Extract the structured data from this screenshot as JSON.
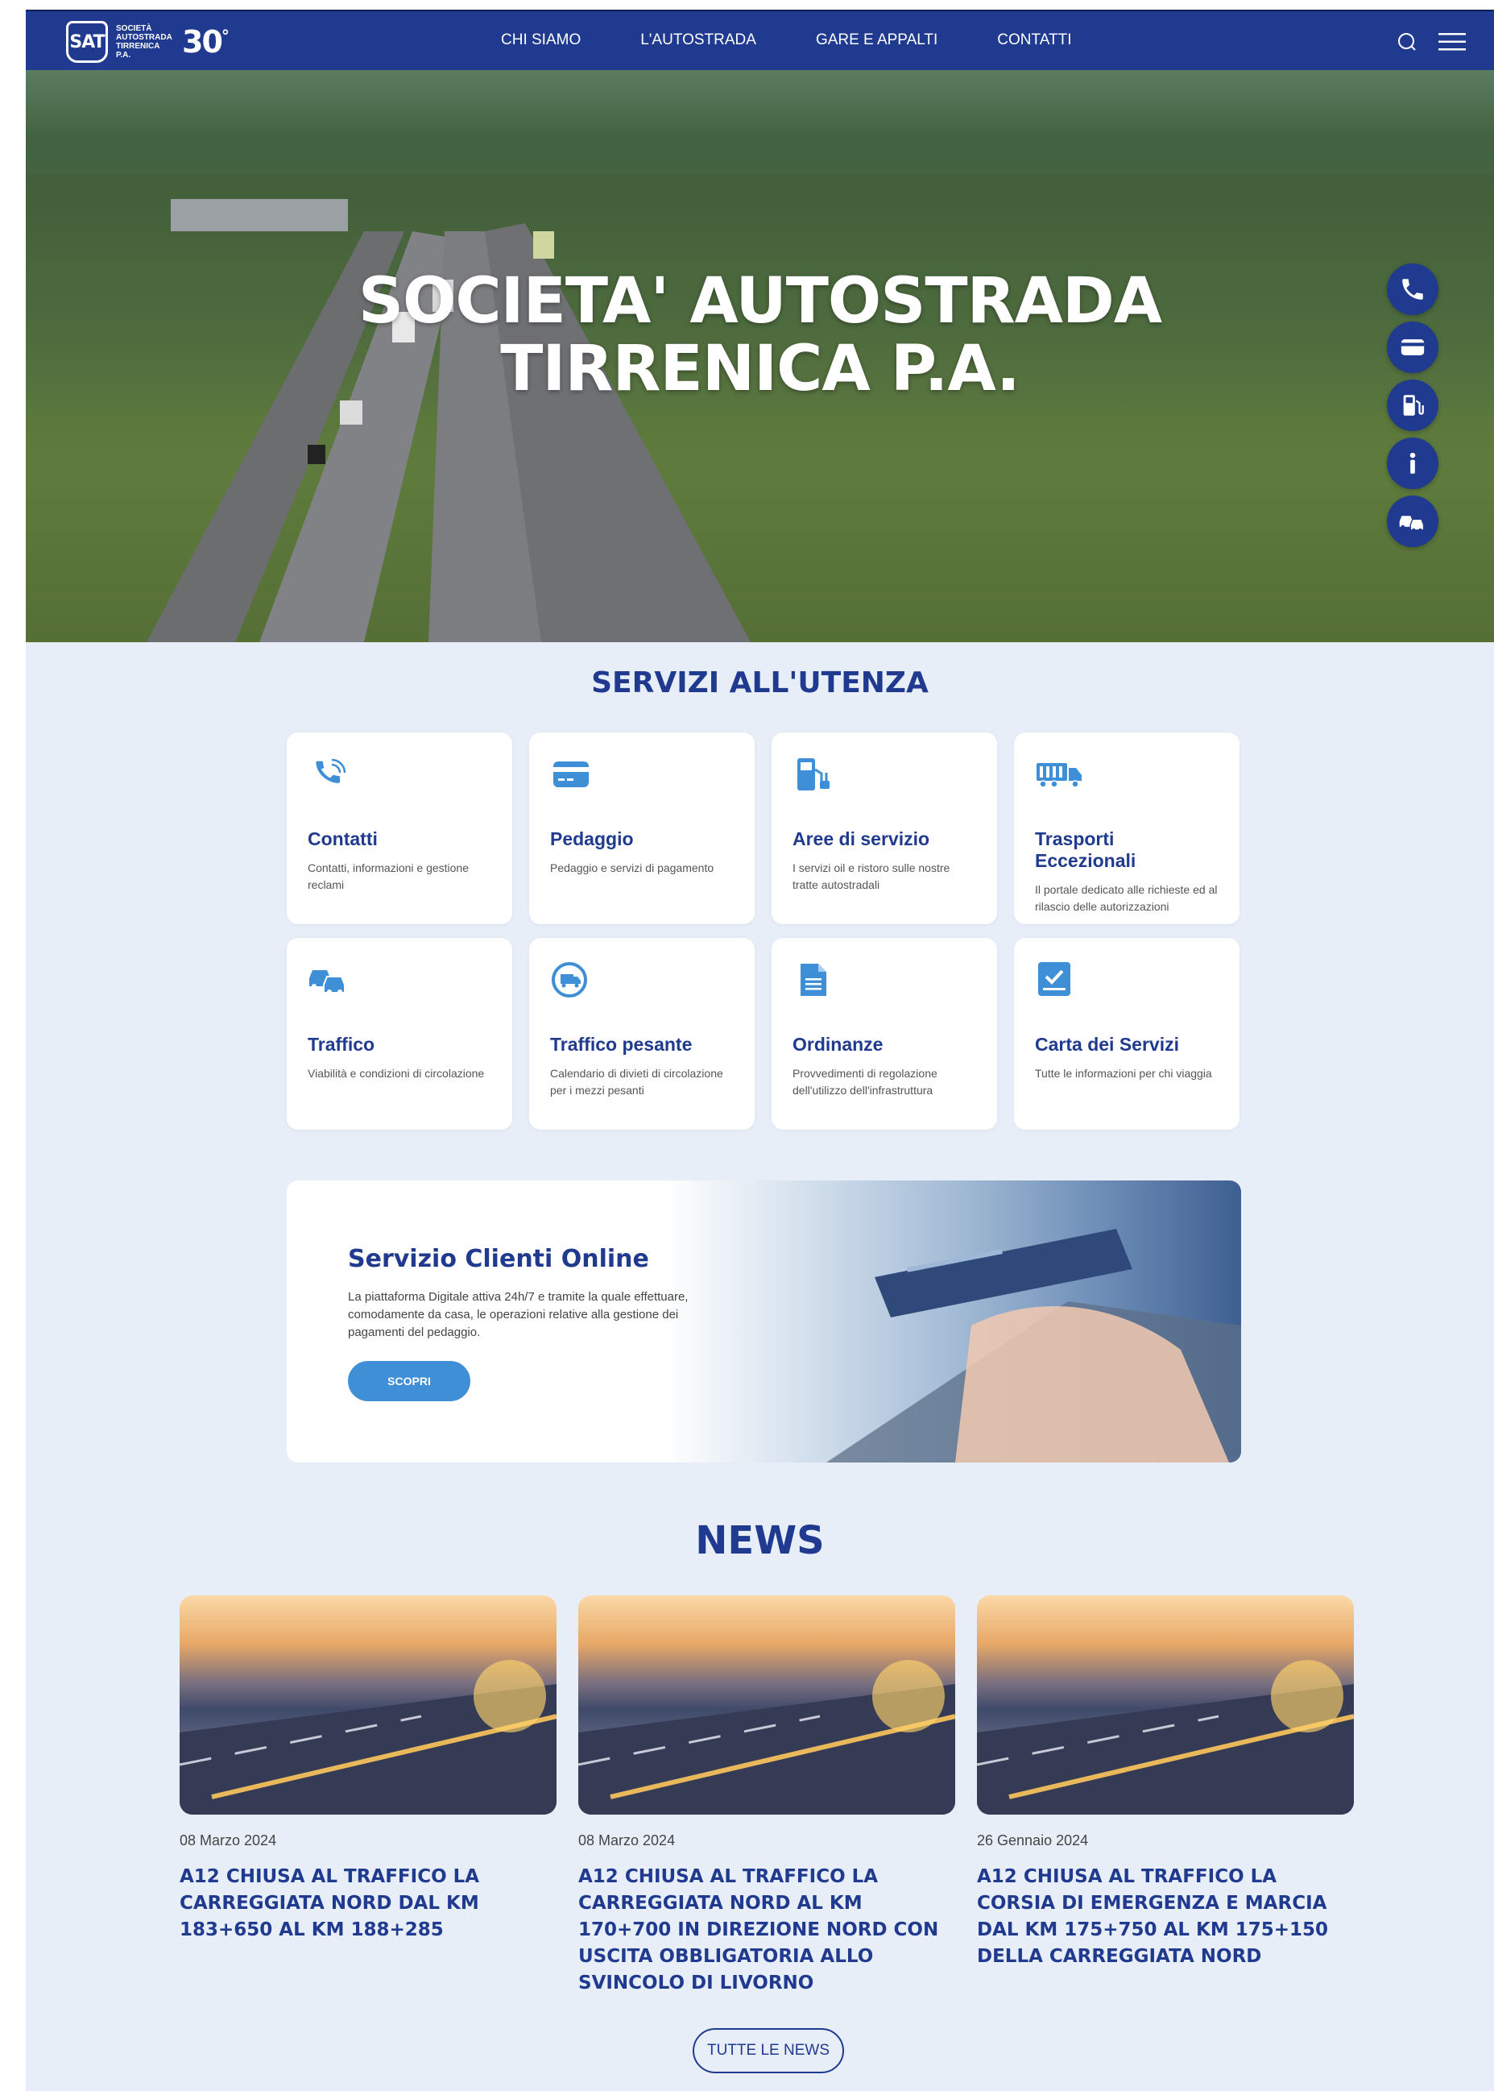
{
  "header": {
    "logo_text": "SAT",
    "logo_subtitle": "SOCIETÀ AUTOSTRADA TIRRENICA P.A.",
    "anniversary": "30",
    "anniversary_mark": "°",
    "menu": [
      {
        "label": "CHI SIAMO"
      },
      {
        "label": "L'AUTOSTRADA"
      },
      {
        "label": "GARE E APPALTI"
      },
      {
        "label": "CONTATTI"
      }
    ],
    "icons": [
      "search-icon",
      "hamburger-menu-icon"
    ]
  },
  "hero": {
    "title_line1": "SOCIETA' AUTOSTRADA",
    "title_line2": "TIRRENICA P.A.",
    "quick_icons": [
      "phone-icon",
      "card-icon",
      "fuel-pump-icon",
      "info-icon",
      "traffic-icon"
    ]
  },
  "services": {
    "title": "SERVIZI ALL'UTENZA",
    "items": [
      {
        "title": "Contatti",
        "desc": "Contatti, informazioni e gestione reclami",
        "icon": "phone-icon"
      },
      {
        "title": "Pedaggio",
        "desc": "Pedaggio e servizi di pagamento",
        "icon": "card-icon"
      },
      {
        "title": "Aree di servizio",
        "desc": "I servizi oil e ristoro sulle nostre tratte autostradali",
        "icon": "fuel-pump-icon"
      },
      {
        "title": "Trasporti Eccezionali",
        "desc": "Il portale dedicato alle richieste ed al rilascio delle autorizzazioni",
        "icon": "truck-icon"
      },
      {
        "title": "Traffico",
        "desc": "Viabilità e condizioni di circolazione",
        "icon": "traffic-icon"
      },
      {
        "title": "Traffico pesante",
        "desc": "Calendario di divieti di circolazione per i mezzi pesanti",
        "icon": "heavy-traffic-icon"
      },
      {
        "title": "Ordinanze",
        "desc": "Provvedimenti di regolazione dell'utilizzo dell'infrastruttura",
        "icon": "document-icon"
      },
      {
        "title": "Carta dei Servizi",
        "desc": "Tutte le informazioni per chi viaggia",
        "icon": "checklist-icon"
      }
    ]
  },
  "promo": {
    "title": "Servizio Clienti Online",
    "text": "La piattaforma Digitale attiva 24h/7 e tramite la quale effettuare, comodamente da casa, le operazioni relative alla gestione dei pagamenti del pedaggio.",
    "button": "SCOPRI"
  },
  "news": {
    "title": "NEWS",
    "items": [
      {
        "date": "08 Marzo 2024",
        "headline": "A12 chiusa al traffico la carreggiata nord dal km 183+650 al km 188+285"
      },
      {
        "date": "08 Marzo 2024",
        "headline": "A12 chiusa al traffico la carreggiata nord al km 170+700 in direzione nord con uscita obbligatoria allo svincolo di Livorno"
      },
      {
        "date": "26 Gennaio 2024",
        "headline": "A12 chiusa al traffico la corsia di emergenza e marcia dal km 175+750 al km 175+150 della carreggiata nord"
      }
    ],
    "all_button": "TUTTE LE NEWS"
  },
  "colors": {
    "brand_blue": "#1f3a8f",
    "accent_blue": "#3f8fd6",
    "page_bg": "#e8eef7"
  }
}
